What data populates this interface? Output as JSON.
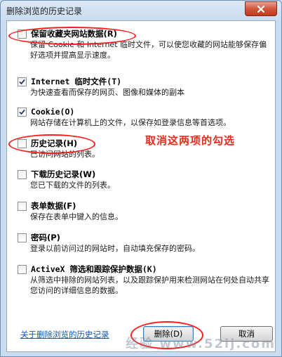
{
  "window": {
    "title": "删除浏览的历史记录",
    "close_icon": "close-icon"
  },
  "items": [
    {
      "label": "保留收藏夹网站数据(R)",
      "description": "保留 Cookie 和 Internet 临时文件，可以使您收藏的网站能够保存偏好选项并提高显示速度。",
      "checked": false
    },
    {
      "label": "Internet 临时文件(T)",
      "description": "为快速查看而保存的网页、图像和媒体的副本",
      "checked": true
    },
    {
      "label": "Cookie(O)",
      "description": "网站存储在计算机上的文件，以保存如登录信息等首选项。",
      "checked": true
    },
    {
      "label": "历史记录(H)",
      "description": "已访问网站的列表。",
      "checked": false
    },
    {
      "label": "下载历史记录(W)",
      "description": "您已下载的文件的列表。",
      "checked": false
    },
    {
      "label": "表单数据(F)",
      "description": "保存在表单中键入的信息。",
      "checked": false
    },
    {
      "label": "密码(P)",
      "description": "登录以前访问过的网站时，自动填充保存的密码。",
      "checked": false
    },
    {
      "label": "ActiveX 筛选和跟踪保护数据(K)",
      "description": "从筛选中排除的网站列表，以及跟踪保护用来检测网站在何处自动共享您访问的详细信息的数据。",
      "checked": false
    }
  ],
  "annotation": "取消这两项的勾选",
  "footer": {
    "link": "关于删除浏览的历史记录",
    "delete_button": "删除(D)",
    "cancel_button": "取消"
  },
  "watermark": "经验 www.52ij.com",
  "colors": {
    "annotation": "#ea2a1e",
    "link": "#0b58b8",
    "titlebar": "#c9dcf0"
  }
}
